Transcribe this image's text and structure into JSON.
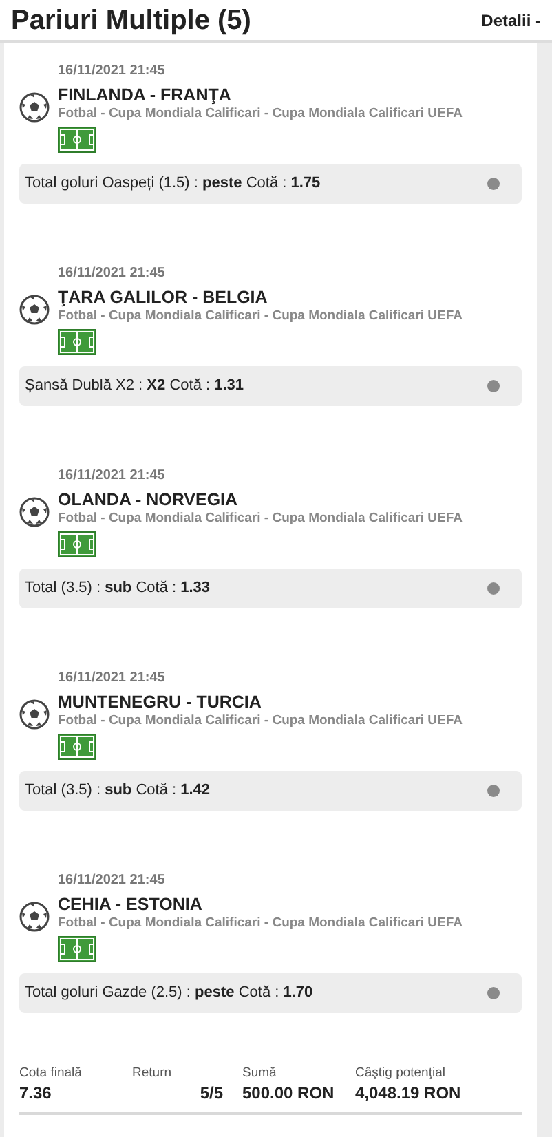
{
  "header": {
    "title": "Pariuri Multiple (5)",
    "details": "Detalii -"
  },
  "bets": [
    {
      "date": "16/11/2021 21:45",
      "teams": "FINLANDA - FRANŢA",
      "league": "Fotbal - Cupa Mondiala Calificari - Cupa Mondiala Calificari UEFA",
      "selection": "Total goluri Oaspeți (1.5) : **peste** Cotă : **1.75**"
    },
    {
      "date": "16/11/2021 21:45",
      "teams": "ŢARA GALILOR - BELGIA",
      "league": "Fotbal - Cupa Mondiala Calificari - Cupa Mondiala Calificari UEFA",
      "selection": "Șansă Dublă X2 : **X2** Cotă : **1.31**"
    },
    {
      "date": "16/11/2021 21:45",
      "teams": "OLANDA - NORVEGIA",
      "league": "Fotbal - Cupa Mondiala Calificari - Cupa Mondiala Calificari UEFA",
      "selection": "Total (3.5) : **sub** Cotă : **1.33**"
    },
    {
      "date": "16/11/2021 21:45",
      "teams": "MUNTENEGRU - TURCIA",
      "league": "Fotbal - Cupa Mondiala Calificari - Cupa Mondiala Calificari UEFA",
      "selection": "Total (3.5) : **sub** Cotă : **1.42**"
    },
    {
      "date": "16/11/2021 21:45",
      "teams": "CEHIA - ESTONIA",
      "league": "Fotbal - Cupa Mondiala Calificari - Cupa Mondiala Calificari UEFA",
      "selection": "Total goluri Gazde (2.5) : **peste** Cotă : **1.70**"
    }
  ],
  "summary": [
    {
      "label": "Cota finală",
      "value": "7.36"
    },
    {
      "label": "Return",
      "value": "5/5"
    },
    {
      "label": "Sumă",
      "value": "500.00 RON"
    },
    {
      "label": "Câştig potenţial",
      "value": "4,048.19 RON"
    }
  ]
}
